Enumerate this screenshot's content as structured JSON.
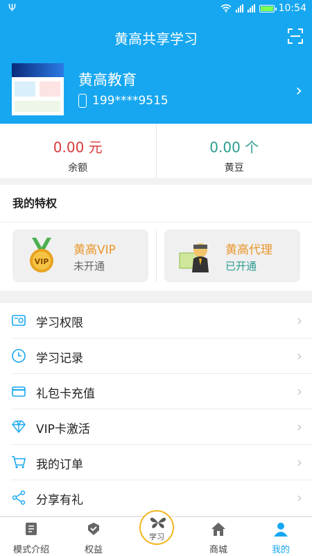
{
  "status_bar": {
    "time": "10:54"
  },
  "header": {
    "title": "黄高共享学习",
    "scan_icon": "scan-icon"
  },
  "profile": {
    "name": "黄高教育",
    "phone": "199****9515"
  },
  "balance": {
    "yuan": {
      "value": "0.00 元",
      "label": "余额",
      "color": "#d83a3a"
    },
    "beans": {
      "value": "0.00 个",
      "label": "黄豆",
      "color": "#2a9b8f"
    }
  },
  "privileges": {
    "title": "我的特权",
    "vip": {
      "name": "黄高VIP",
      "status": "未开通",
      "status_color": "#666666"
    },
    "agent": {
      "name": "黄高代理",
      "status": "已开通",
      "status_color": "#2a9b8f"
    }
  },
  "menu": [
    {
      "label": "学习权限",
      "icon": "certificate-icon"
    },
    {
      "label": "学习记录",
      "icon": "clock-icon"
    },
    {
      "label": "礼包卡充值",
      "icon": "card-icon"
    },
    {
      "label": "VIP卡激活",
      "icon": "diamond-icon"
    },
    {
      "label": "我的订单",
      "icon": "cart-icon"
    },
    {
      "label": "分享有礼",
      "icon": "share-icon"
    }
  ],
  "bottom_nav": {
    "items": [
      {
        "label": "模式介绍"
      },
      {
        "label": "权益"
      },
      {
        "label": "学习"
      },
      {
        "label": "商城"
      },
      {
        "label": "我的"
      }
    ],
    "active": "我的"
  },
  "colors": {
    "primary": "#16a7f0",
    "accent_gold": "#e8962a"
  }
}
